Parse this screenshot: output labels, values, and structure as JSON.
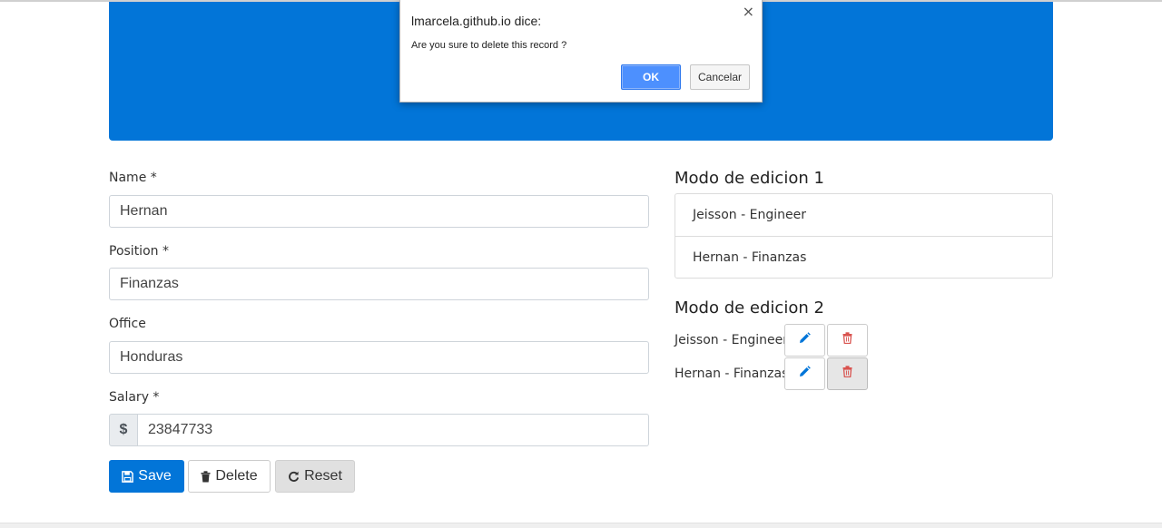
{
  "dialog": {
    "title": "lmarcela.github.io dice:",
    "message": "Are you sure to delete this record ?",
    "close_glyph": "×",
    "ok_label": "OK",
    "cancel_label": "Cancelar"
  },
  "form": {
    "name_label": "Name *",
    "name_value": "Hernan",
    "position_label": "Position *",
    "position_value": "Finanzas",
    "office_label": "Office",
    "office_value": "Honduras",
    "salary_label": "Salary *",
    "salary_currency": "$",
    "salary_value": "23847733",
    "save_label": "Save",
    "delete_label": "Delete",
    "reset_label": "Reset"
  },
  "edit_mode_1": {
    "heading": "Modo de edicion 1",
    "items": [
      "Jeisson - Engineer",
      "Hernan - Finanzas"
    ]
  },
  "edit_mode_2": {
    "heading": "Modo de edicion 2",
    "rows": [
      {
        "label": "Jeisson - Engineer"
      },
      {
        "label": "Hernan - Finanzas"
      }
    ]
  },
  "colors": {
    "primary": "#0275d8",
    "danger": "#d9534f",
    "dialog_ok": "#4d90fe"
  },
  "icons": {
    "save": "floppy-disk-icon",
    "delete": "trash-icon",
    "reset": "refresh-icon",
    "edit": "pencil-icon",
    "remove": "trash-icon"
  }
}
